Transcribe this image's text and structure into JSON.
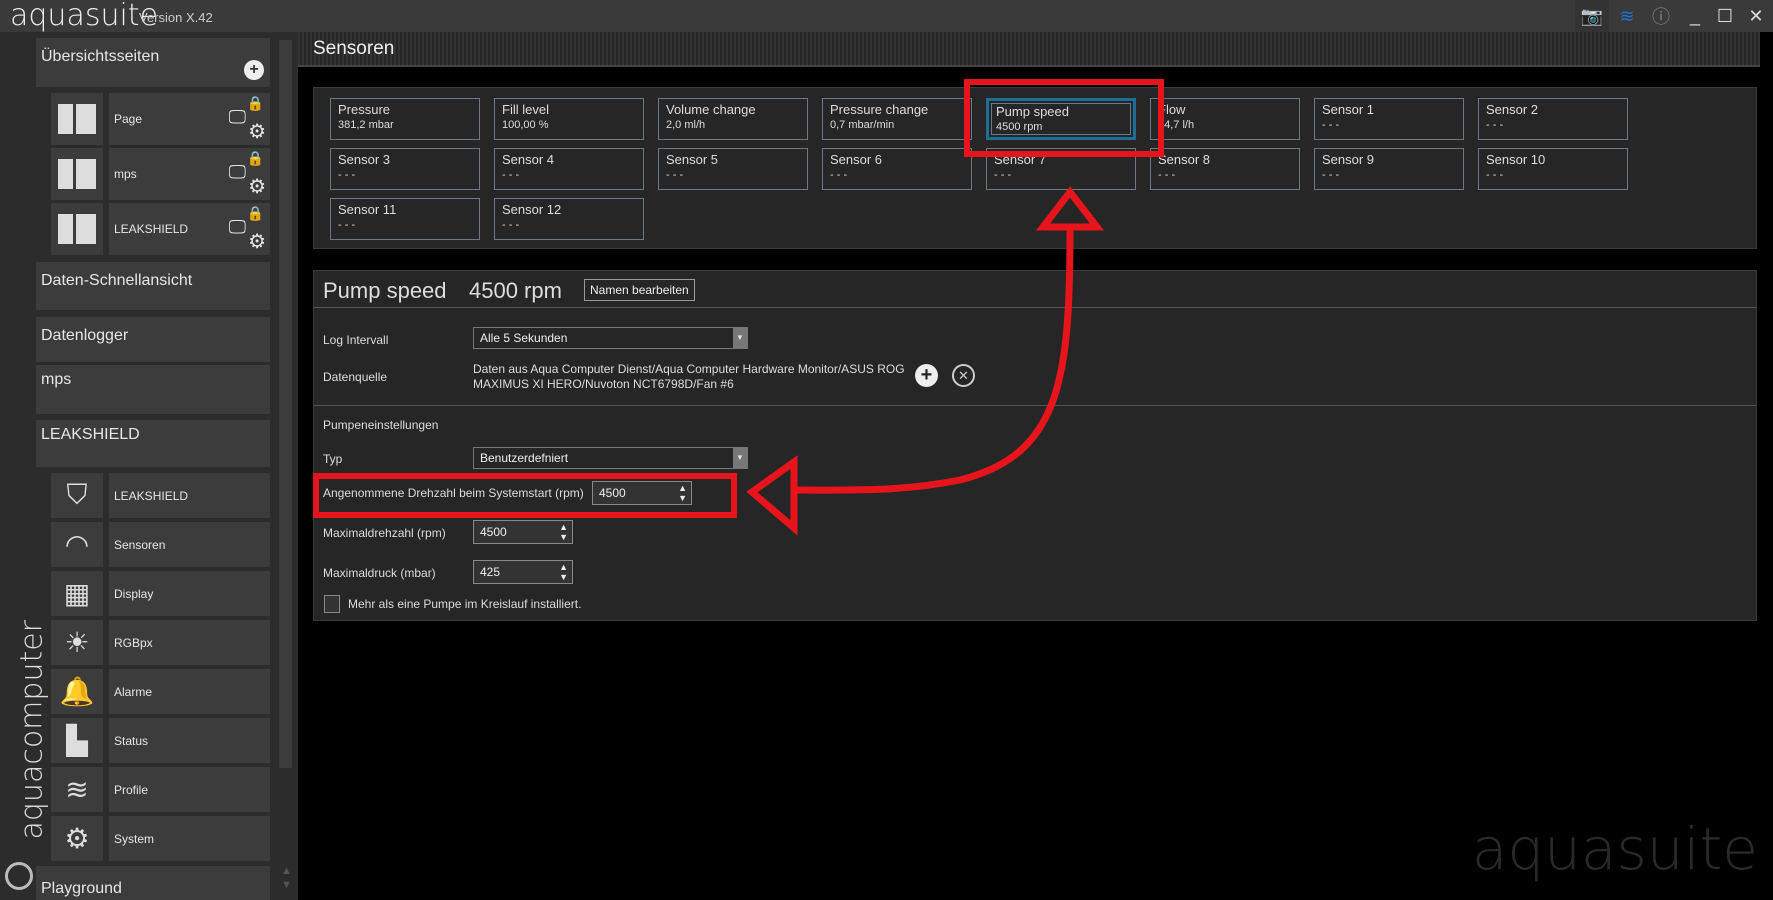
{
  "app": {
    "title": "aquasuite",
    "version": "Version X.42",
    "brand_vertical": "aquacomputer",
    "watermark": "aquasuite"
  },
  "titlebar": {
    "icons": [
      "camera-add-icon",
      "layers-icon",
      "info-icon",
      "minimize-icon",
      "maximize-icon",
      "close-icon"
    ],
    "accent": "#1a73d9"
  },
  "sidebar": {
    "overview": {
      "label": "Übersichtsseiten",
      "pages": [
        {
          "label": "Page"
        },
        {
          "label": "mps"
        },
        {
          "label": "LEAKSHIELD"
        }
      ]
    },
    "sections": [
      {
        "label": "Daten-Schnellansicht"
      },
      {
        "label": "Datenlogger"
      },
      {
        "label": "mps"
      },
      {
        "label": "LEAKSHIELD"
      }
    ],
    "device_items": [
      {
        "label": "LEAKSHIELD",
        "icon": "shield-drop-icon"
      },
      {
        "label": "Sensoren",
        "icon": "gauge-icon"
      },
      {
        "label": "Display",
        "icon": "display-icon"
      },
      {
        "label": "RGBpx",
        "icon": "bulb-icon"
      },
      {
        "label": "Alarme",
        "icon": "bell-icon"
      },
      {
        "label": "Status",
        "icon": "bar-chart-icon"
      },
      {
        "label": "Profile",
        "icon": "layers-icon"
      },
      {
        "label": "System",
        "icon": "gear-icon"
      }
    ],
    "bottom": {
      "label": "Playground"
    }
  },
  "main": {
    "title": "Sensoren",
    "sensors": [
      {
        "name": "Pressure",
        "value": "381,2 mbar"
      },
      {
        "name": "Fill level",
        "value": "100,00 %"
      },
      {
        "name": "Volume change",
        "value": "2,0 ml/h"
      },
      {
        "name": "Pressure change",
        "value": "0,7 mbar/min"
      },
      {
        "name": "Pump speed",
        "value": "4500 rpm",
        "selected": true
      },
      {
        "name": "Flow",
        "value": "14,7 l/h"
      },
      {
        "name": "Sensor 1",
        "value": "- - -"
      },
      {
        "name": "Sensor 2",
        "value": "- - -"
      },
      {
        "name": "Sensor 3",
        "value": "- - -"
      },
      {
        "name": "Sensor 4",
        "value": "- - -"
      },
      {
        "name": "Sensor 5",
        "value": "- - -"
      },
      {
        "name": "Sensor 6",
        "value": "- - -"
      },
      {
        "name": "Sensor 7",
        "value": "- - -"
      },
      {
        "name": "Sensor 8",
        "value": "- - -"
      },
      {
        "name": "Sensor 9",
        "value": "- - -"
      },
      {
        "name": "Sensor 10",
        "value": "- - -"
      },
      {
        "name": "Sensor 11",
        "value": "- - -"
      },
      {
        "name": "Sensor 12",
        "value": "- - -"
      }
    ],
    "detail": {
      "name": "Pump speed",
      "value": "4500 rpm",
      "rename_label": "Namen bearbeiten",
      "log_label": "Log Intervall",
      "log_value": "Alle 5 Sekunden",
      "source_label": "Datenquelle",
      "source_line1": "Daten aus Aqua Computer Dienst/Aqua Computer Hardware Monitor/ASUS ROG",
      "source_line2": "MAXIMUS XI HERO/Nuvoton NCT6798D/Fan #6",
      "pump_section": "Pumpeneinstellungen",
      "type_label": "Typ",
      "type_value": "Benutzerdefniert",
      "startup_label": "Angenommene Drehzahl beim Systemstart (rpm)",
      "startup_value": "4500",
      "maxspeed_label": "Maximaldrehzahl (rpm)",
      "maxspeed_value": "4500",
      "maxpressure_label": "Maximaldruck (mbar)",
      "maxpressure_value": "425",
      "multi_pump_label": "Mehr als eine Pumpe im Kreislauf installiert.",
      "multi_pump_checked": false
    }
  },
  "annotation_color": "#e8141c"
}
